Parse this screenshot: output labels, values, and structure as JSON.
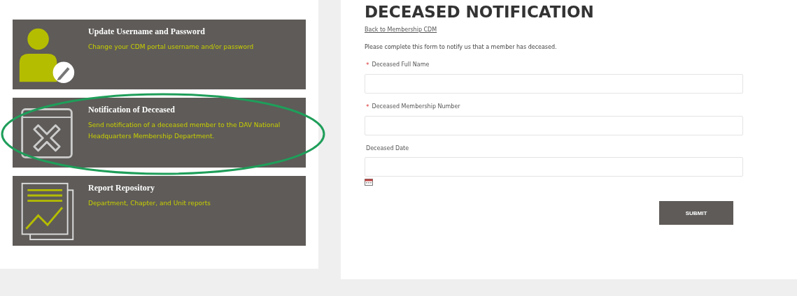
{
  "cards": [
    {
      "kind": "user",
      "title": "Update Username and Password",
      "description": "Change your CDM portal username and/or password",
      "highlighted": false
    },
    {
      "kind": "cancel",
      "title": "Notification of Deceased",
      "description": "Send notification of a deceased member to the DAV National Headquarters Membership Department.",
      "highlighted": true
    },
    {
      "kind": "report",
      "title": "Report Repository",
      "description": "Department, Chapter, and Unit reports",
      "highlighted": false
    }
  ],
  "form": {
    "title": "DECEASED NOTIFICATION",
    "required_mark": "*",
    "back_link": "Back to Membership CDM",
    "intro": "Please complete this form to notify us that a member has deceased.",
    "fields": [
      {
        "label": "Deceased Full Name",
        "required": true,
        "kind": "text"
      },
      {
        "label": "Deceased Membership Number",
        "required": true,
        "kind": "text"
      },
      {
        "label": "Deceased Date",
        "required": false,
        "kind": "date"
      }
    ],
    "submit": "SUBMIT"
  }
}
